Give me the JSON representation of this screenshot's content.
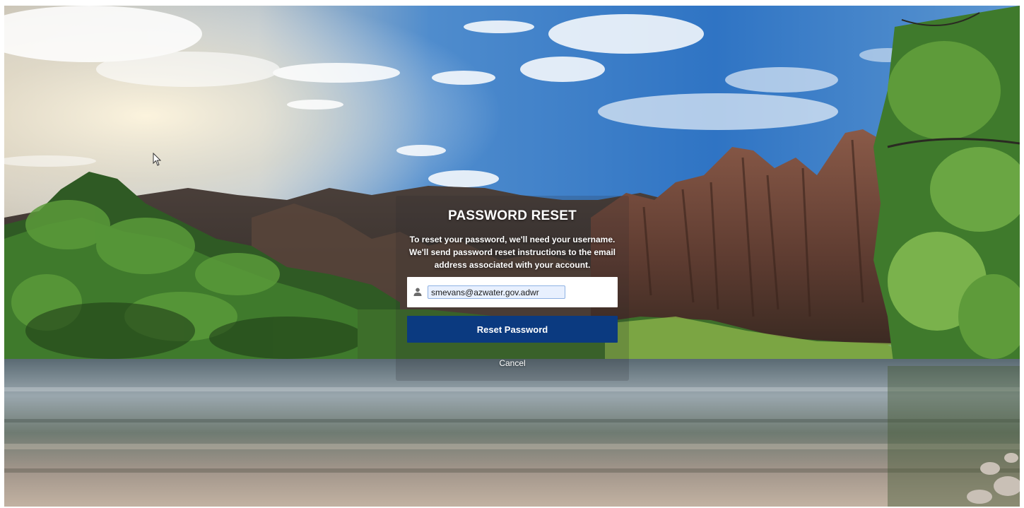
{
  "page": {
    "background_image": "mountain-river-landscape"
  },
  "reset_form": {
    "title": "PASSWORD RESET",
    "description_lines": [
      "To reset your password, we'll need your username.",
      "We'll send password reset instructions to the email",
      "address associated with your account."
    ],
    "username_value": "smevans@azwater.gov.adwr",
    "username_icon": "user-icon",
    "reset_button_label": "Reset Password",
    "cancel_label": "Cancel"
  },
  "colors": {
    "button": "#0b3a80",
    "input_autofill": "#e8f0fe",
    "text_on_background": "#ffffff"
  }
}
